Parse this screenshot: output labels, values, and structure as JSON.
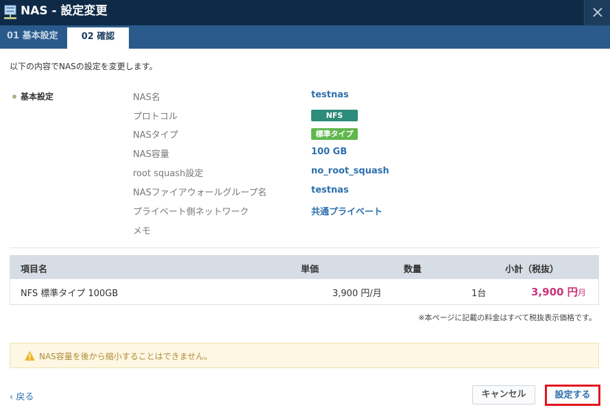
{
  "window": {
    "title": "NAS - 設定変更",
    "close_icon": "close-icon"
  },
  "tabs": [
    {
      "label": "01 基本設定",
      "active": false
    },
    {
      "label": "02 確認",
      "active": true
    }
  ],
  "intro": "以下の内容でNASの設定を変更します。",
  "section": {
    "label": "基本設定",
    "fields": [
      {
        "label": "NAS名",
        "value": "testnas"
      },
      {
        "label": "プロトコル",
        "value": "NFS",
        "badge_color": "#2d8c7a"
      },
      {
        "label": "NASタイプ",
        "value": "標準タイプ",
        "badge_color": "#5fb84c"
      },
      {
        "label": "NAS容量",
        "value": "100 GB"
      },
      {
        "label": "root squash設定",
        "value": "no_root_squash"
      },
      {
        "label": "NASファイアウォールグループ名",
        "value": "testnas"
      },
      {
        "label": "プライベート側ネットワーク",
        "value": "共通プライベート"
      },
      {
        "label": "メモ",
        "value": ""
      }
    ]
  },
  "price_table": {
    "headers": [
      "項目名",
      "単価",
      "数量",
      "小計（税抜）"
    ],
    "rows": [
      {
        "item": "NFS 標準タイプ 100GB",
        "unit_price": "3,900 円/月",
        "quantity": "1台",
        "subtotal": "3,900 円",
        "subtotal_unit": "/月"
      }
    ]
  },
  "note": "※本ページに記載の料金はすべて税抜表示価格です。",
  "warning": {
    "icon": "warning-icon",
    "text": "NAS容量を後から縮小することはできません。"
  },
  "footer": {
    "back_label": "戻る",
    "cancel_label": "キャンセル",
    "submit_label": "設定する"
  },
  "colors": {
    "titlebar": "#0e2a47",
    "tab_bar": "#2a5a8c",
    "value_text": "#2d6fae",
    "subtotal": "#c9357a",
    "highlight_border": "#e4121e"
  }
}
